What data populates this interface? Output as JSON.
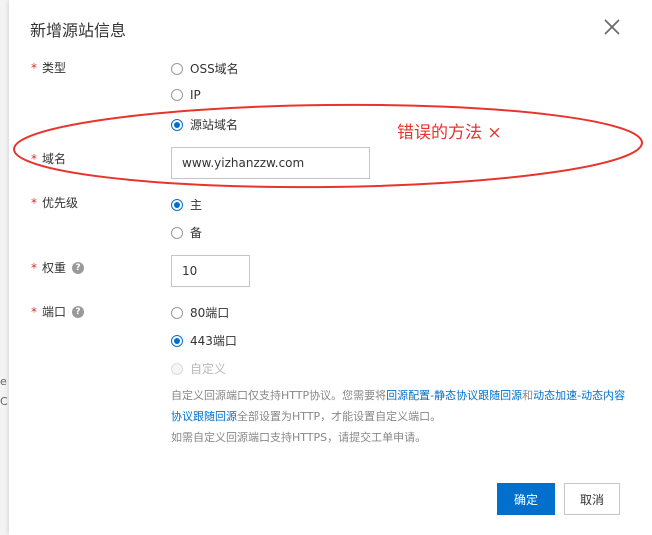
{
  "dialog": {
    "title": "新增源站信息"
  },
  "form": {
    "type": {
      "label": "类型",
      "options": [
        "OSS域名",
        "IP",
        "源站域名"
      ],
      "selected": "源站域名"
    },
    "domain": {
      "label": "域名",
      "value": "www.yizhanzzw.com"
    },
    "priority": {
      "label": "优先级",
      "options": [
        "主",
        "备"
      ],
      "selected": "主"
    },
    "weight": {
      "label": "权重",
      "value": "10"
    },
    "port": {
      "label": "端口",
      "options": [
        "80端口",
        "443端口",
        "自定义"
      ],
      "selected": "443端口"
    },
    "required_mark": "*",
    "help_mark": "?"
  },
  "hint": {
    "part1": "自定义回源端口仅支持HTTP协议。您需要将",
    "link1": "回源配置-静态协议跟随回源",
    "part2": "和",
    "link2": "动态加速-动态内容协议跟随回源",
    "part3": "全部设置为HTTP，才能设置自定义端口。",
    "line3": "如需自定义回源端口支持HTTPS，请提交工单申请。"
  },
  "annotation": {
    "text": "错误的方法 ×"
  },
  "buttons": {
    "confirm": "确定",
    "cancel": "取消"
  },
  "background": {
    "glyph1": "e",
    "glyph2": "C"
  },
  "colors": {
    "primary": "#0070cc",
    "annotation_red": "#e8342d",
    "required_red": "#d93026"
  }
}
